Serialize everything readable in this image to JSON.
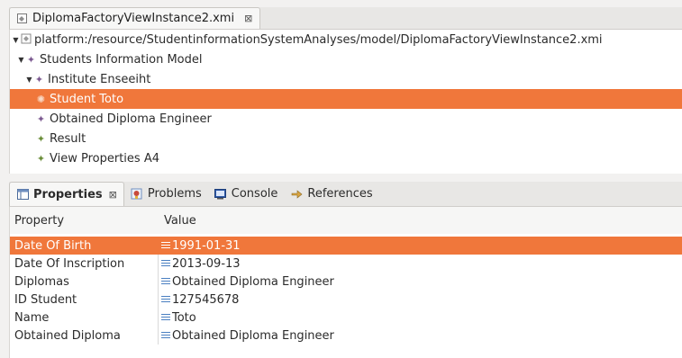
{
  "editor": {
    "tab_label": "DiplomaFactoryViewInstance2.xmi",
    "tab_close": "⊠",
    "tree": [
      {
        "label": "platform:/resource/StudentinformationSystemAnalyses/model/DiplomaFactoryViewInstance2.xmi",
        "icon": "resource-icon",
        "expanded": true
      },
      {
        "label": "Students Information Model",
        "icon": "model-icon",
        "expanded": true
      },
      {
        "label": "Institute Enseeiht",
        "icon": "model-icon",
        "expanded": true
      },
      {
        "label": "Student Toto",
        "icon": "leaf-icon",
        "selected": true
      },
      {
        "label": "Obtained Diploma Engineer",
        "icon": "model-icon"
      },
      {
        "label": "Result",
        "icon": "leaf-icon"
      },
      {
        "label": "View Properties A4",
        "icon": "leaf-icon"
      }
    ]
  },
  "panel": {
    "tabs": [
      {
        "label": "Properties",
        "icon": "properties-icon",
        "close": "⊠",
        "active": true
      },
      {
        "label": "Problems",
        "icon": "problems-icon"
      },
      {
        "label": "Console",
        "icon": "console-icon"
      },
      {
        "label": "References",
        "icon": "references-icon"
      }
    ],
    "columns": [
      "Property",
      "Value"
    ],
    "rows": [
      {
        "property": "Date Of Birth",
        "value": "1991-01-31",
        "selected": true
      },
      {
        "property": "Date Of Inscription",
        "value": "2013-09-13"
      },
      {
        "property": "Diplomas",
        "value": "Obtained Diploma Engineer"
      },
      {
        "property": "ID Student",
        "value": "127545678"
      },
      {
        "property": "Name",
        "value": "Toto"
      },
      {
        "property": "Obtained Diploma",
        "value": "Obtained Diploma Engineer"
      }
    ]
  },
  "colors": {
    "selection": "#f0773b",
    "value_icon": "#4a7fc1"
  }
}
